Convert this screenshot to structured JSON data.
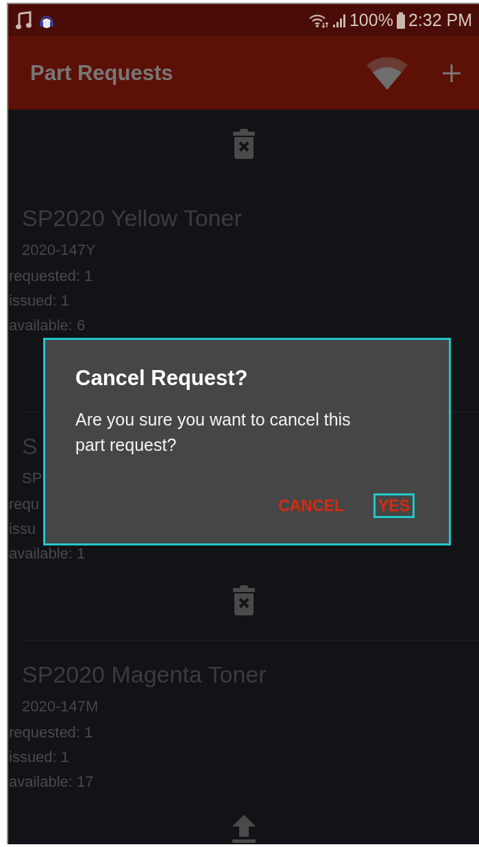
{
  "status_bar": {
    "battery": "100%",
    "time": "2:32 PM"
  },
  "app_bar": {
    "title": "Part Requests"
  },
  "list": {
    "leading_action": {
      "kind": "delete"
    },
    "items": [
      {
        "title": "SP2020 Yellow Toner",
        "part_number": "2020-147Y",
        "requested": "requested: 1",
        "issued": "issued: 1",
        "available": "available: 6"
      },
      {
        "title": "S",
        "part_number": "SP",
        "requested": "requ",
        "issued": "issu",
        "available": "available: 1",
        "action": {
          "kind": "delete"
        }
      },
      {
        "title": "SP2020 Magenta Toner",
        "part_number": "2020-147M",
        "requested": "requested: 1",
        "issued": "issued: 1",
        "available": "available: 17",
        "action": {
          "kind": "upload"
        }
      }
    ]
  },
  "dialog": {
    "title": "Cancel Request?",
    "message": "Are you sure you want to cancel this part request?",
    "buttons": [
      {
        "label": "CANCEL",
        "highlighted": false
      },
      {
        "label": "YES",
        "highlighted": true
      }
    ]
  }
}
